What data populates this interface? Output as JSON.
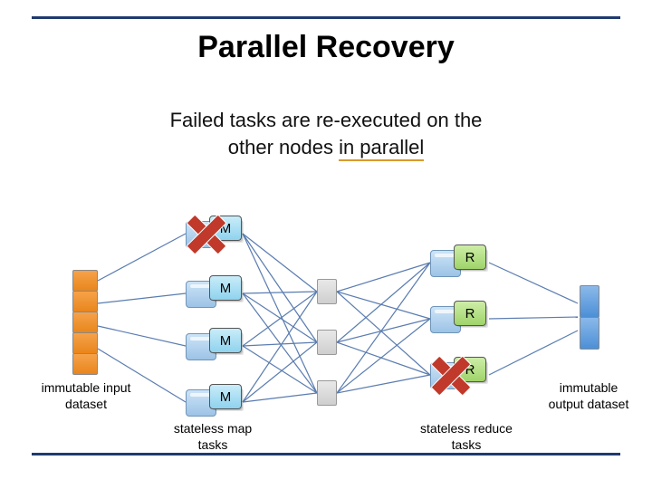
{
  "title": "Parallel Recovery",
  "subtitle_line1": "Failed tasks are re-executed on the",
  "subtitle_line2_a": "other nodes ",
  "subtitle_line2_b": "in parallel",
  "labels": {
    "input": "immutable input dataset",
    "output": "immutable output dataset",
    "map": "stateless map tasks",
    "reduce": "stateless reduce tasks"
  },
  "tasks": {
    "map_label": "M",
    "reduce_label": "R"
  },
  "diagram": {
    "map_nodes": 4,
    "reduce_nodes": 3,
    "failed_map_index": 0,
    "failed_reduce_index": 2,
    "intermediate_blocks": 3,
    "input_segments": 5,
    "output_segments": 2
  },
  "colors": {
    "rule": "#1f3a6e",
    "underline": "#d99a2b",
    "map_task": "#8fd3ee",
    "reduce_task": "#9fd36a",
    "input": "#e8861d",
    "output": "#4c8fd6",
    "fail": "#c0392b"
  }
}
